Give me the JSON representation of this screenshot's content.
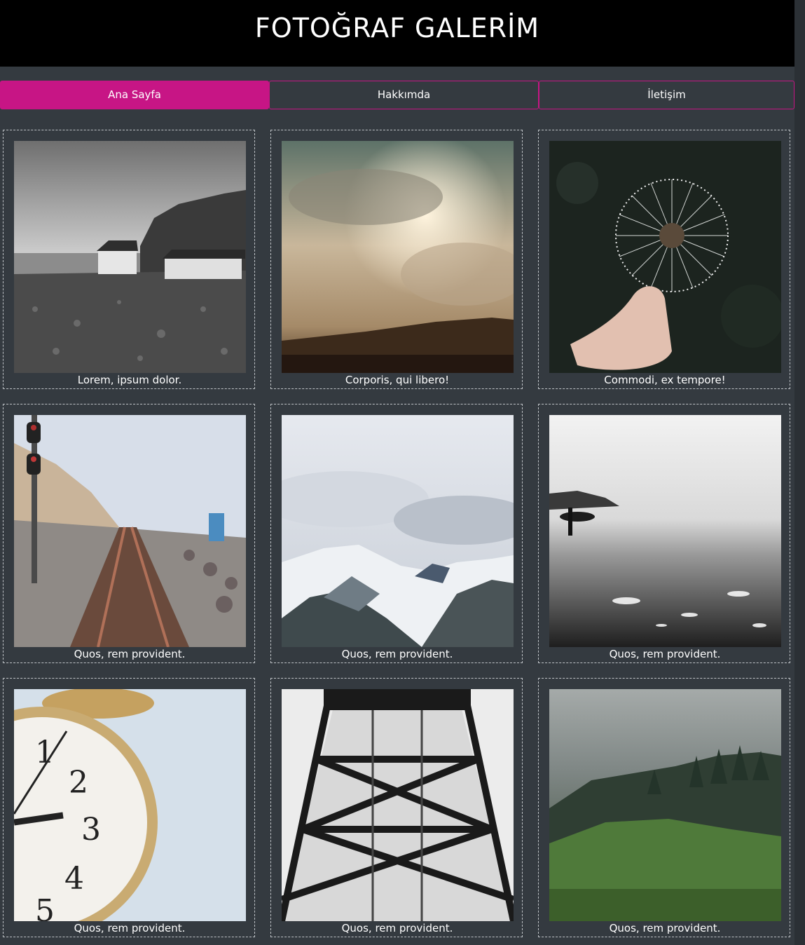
{
  "header": {
    "title": "FOTOĞRAF GALERİM"
  },
  "nav": {
    "items": [
      {
        "label": "Ana Sayfa",
        "active": true
      },
      {
        "label": "Hakkımda",
        "active": false
      },
      {
        "label": "İletişim",
        "active": false
      }
    ],
    "accent_color": "#c71585"
  },
  "gallery": {
    "cards": [
      {
        "caption": "Lorem, ipsum dolor.",
        "photo": "coastal-houses-cliff"
      },
      {
        "caption": "Corporis, qui libero!",
        "photo": "sunlit-clouds-desert"
      },
      {
        "caption": "Commodi, ex tempore!",
        "photo": "dandelion-in-hand"
      },
      {
        "caption": "Quos, rem provident.",
        "photo": "railway-tracks-coast"
      },
      {
        "caption": "Quos, rem provident.",
        "photo": "snowy-mountains"
      },
      {
        "caption": "Quos, rem provident.",
        "photo": "surfer-on-beach"
      },
      {
        "caption": "Quos, rem provident.",
        "photo": "alarm-clock"
      },
      {
        "caption": "Quos, rem provident.",
        "photo": "steel-bridge-tower"
      },
      {
        "caption": "Quos, rem provident.",
        "photo": "misty-forest-hill"
      }
    ]
  }
}
